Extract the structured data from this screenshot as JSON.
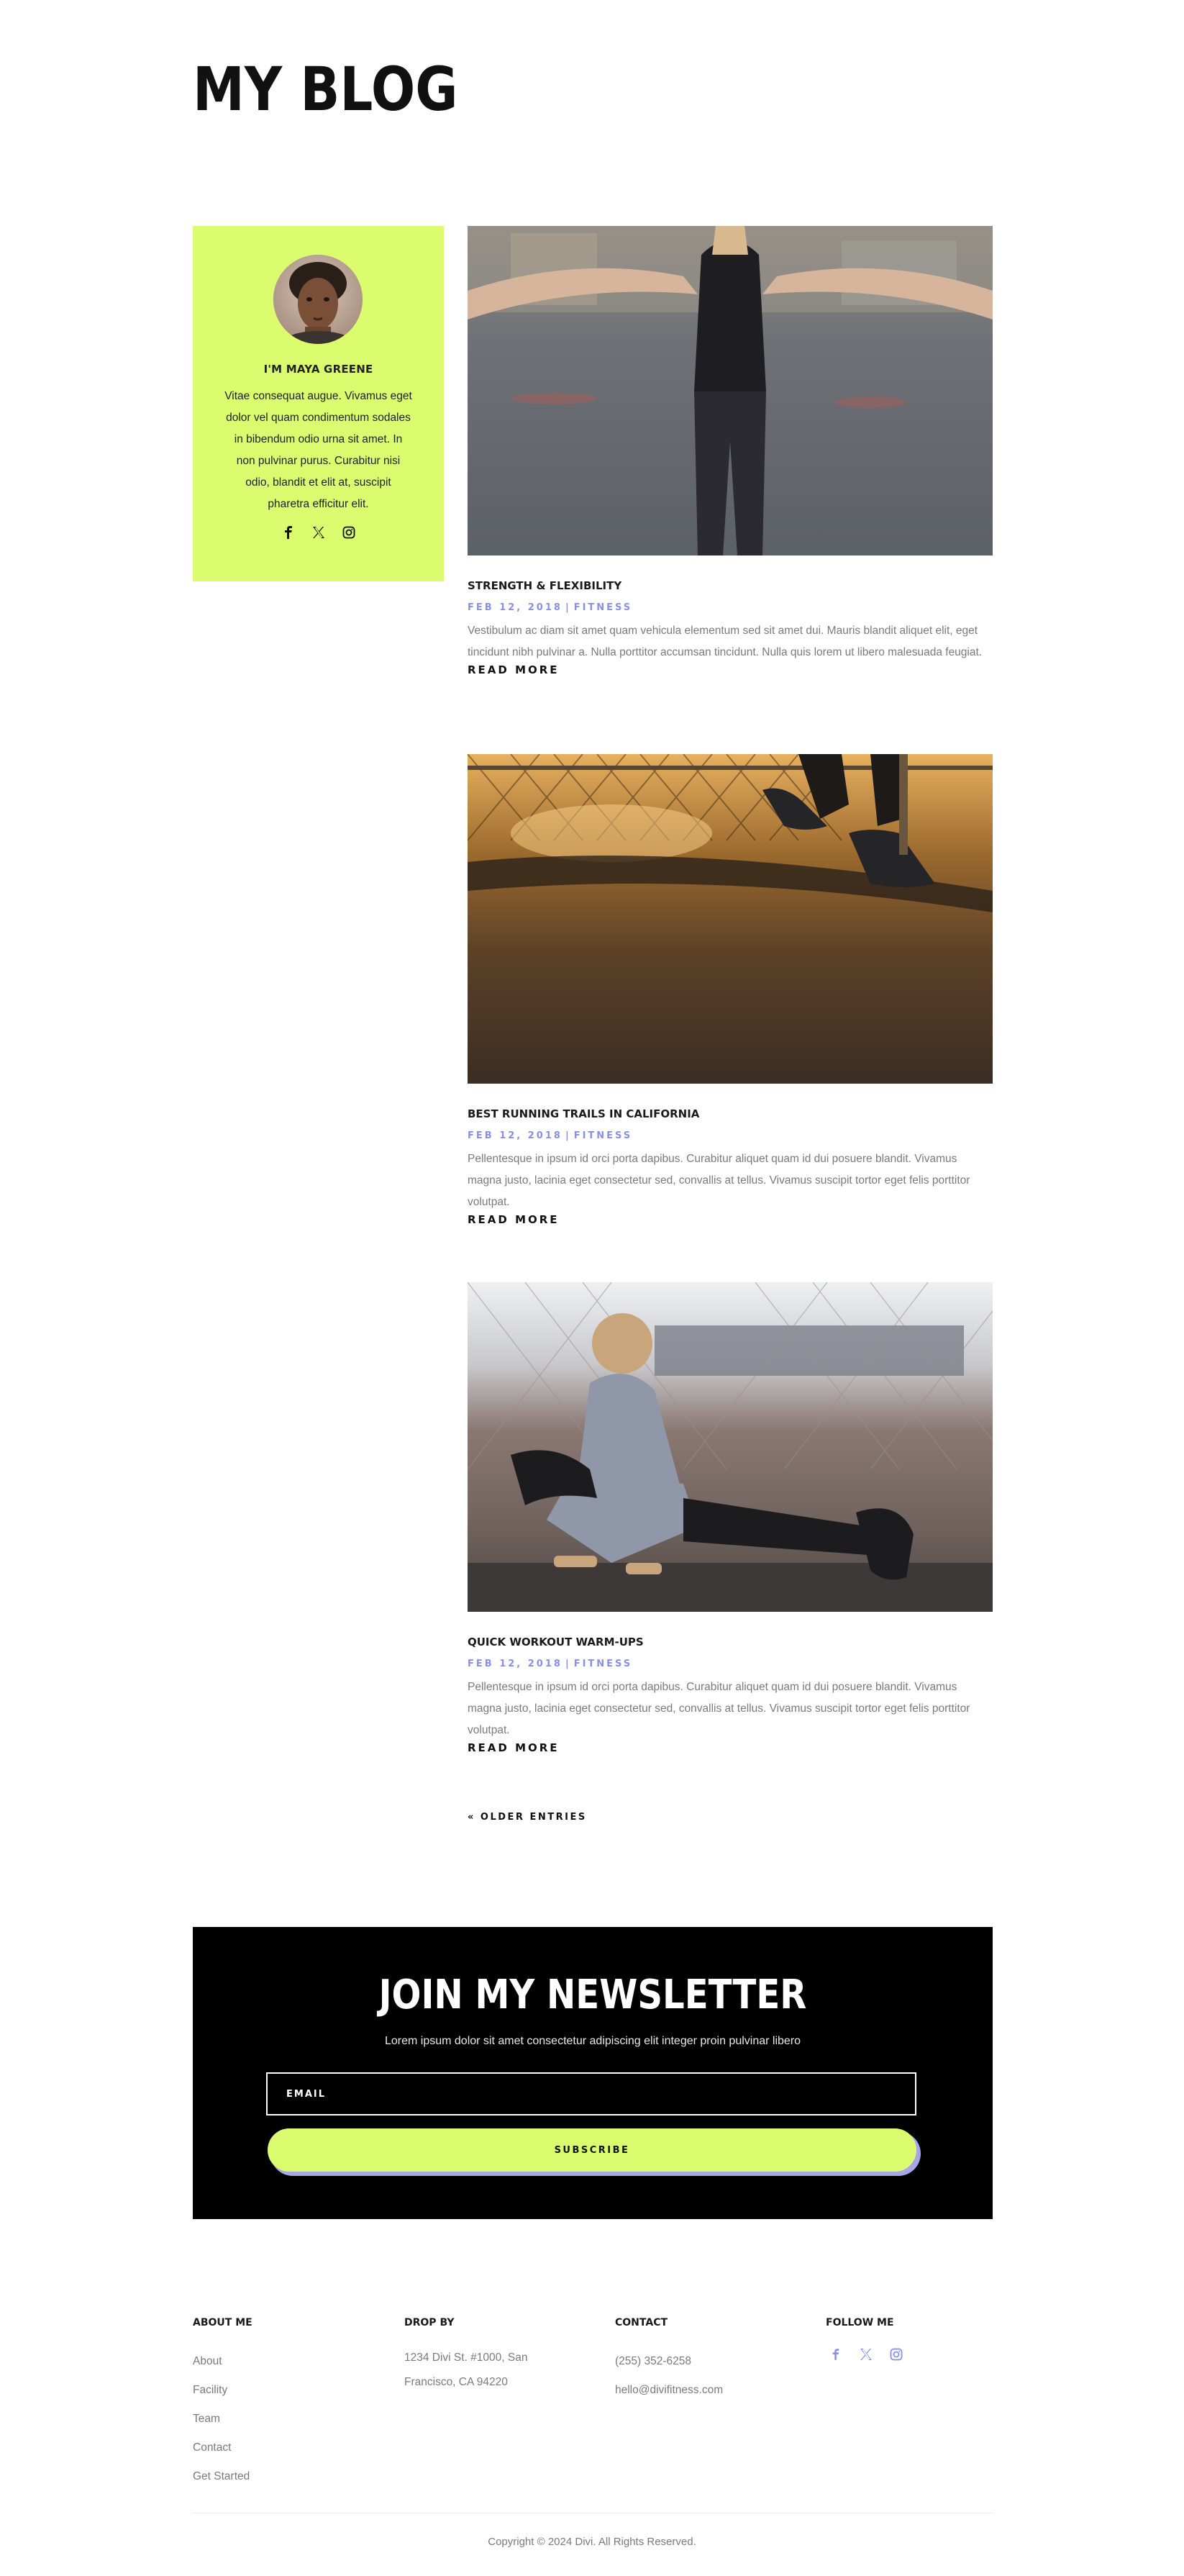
{
  "page": {
    "title": "MY BLOG"
  },
  "profile": {
    "name": "I'M MAYA GREENE",
    "bio": "Vitae consequat augue. Vivamus eget dolor vel quam condimentum sodales in bibendum odio urna sit amet. In non pulvinar purus. Curabitur nisi odio, blandit et elit at, suscipit pharetra efficitur elit.",
    "social_icons": [
      "facebook-icon",
      "x-twitter-icon",
      "instagram-icon"
    ]
  },
  "posts": [
    {
      "title": "STRENGTH & FLEXIBILITY",
      "date": "FEB 12, 2018",
      "category": "FITNESS",
      "excerpt": "Vestibulum ac diam sit amet quam vehicula elementum sed sit amet dui. Mauris blandit aliquet elit, eget tincidunt nibh pulvinar a. Nulla porttitor accumsan tincidunt. Nulla quis lorem ut libero malesuada feugiat.",
      "read_more": "READ MORE"
    },
    {
      "title": "BEST RUNNING TRAILS IN CALIFORNIA",
      "date": "FEB 12, 2018",
      "category": "FITNESS",
      "excerpt": "Pellentesque in ipsum id orci porta dapibus. Curabitur aliquet quam id dui posuere blandit. Vivamus magna justo, lacinia eget consectetur sed, convallis at tellus. Vivamus suscipit tortor eget felis porttitor volutpat.",
      "read_more": "READ MORE"
    },
    {
      "title": "QUICK WORKOUT WARM-UPS",
      "date": "FEB 12, 2018",
      "category": "FITNESS",
      "excerpt": "Pellentesque in ipsum id orci porta dapibus. Curabitur aliquet quam id dui posuere blandit. Vivamus magna justo, lacinia eget consectetur sed, convallis at tellus. Vivamus suscipit tortor eget felis porttitor volutpat.",
      "read_more": "READ MORE"
    }
  ],
  "meta_separator": "|",
  "pagination": {
    "older": "« OLDER ENTRIES"
  },
  "newsletter": {
    "title": "JOIN MY NEWSLETTER",
    "subtitle": "Lorem ipsum dolor sit amet consectetur adipiscing elit integer proin pulvinar libero",
    "email_placeholder": "EMAIL",
    "button": "SUBSCRIBE"
  },
  "footer": {
    "about": {
      "heading": "ABOUT ME",
      "links": [
        "About",
        "Facility",
        "Team",
        "Contact",
        "Get Started"
      ]
    },
    "drop_by": {
      "heading": "DROP BY",
      "address_line1": "1234 Divi St. #1000, San",
      "address_line2": "Francisco, CA 94220"
    },
    "contact": {
      "heading": "CONTACT",
      "phone": "(255) 352-6258",
      "email": "hello@divifitness.com"
    },
    "follow": {
      "heading": "FOLLOW ME",
      "social_icons": [
        "facebook-icon",
        "x-twitter-icon",
        "instagram-icon"
      ]
    },
    "copyright": "Copyright © 2024 Divi. All Rights Reserved."
  },
  "colors": {
    "accent_lime": "#dbfc6f",
    "accent_lavender": "#8a8fe3",
    "dark": "#000000",
    "text_gray": "#7a7a7a"
  }
}
